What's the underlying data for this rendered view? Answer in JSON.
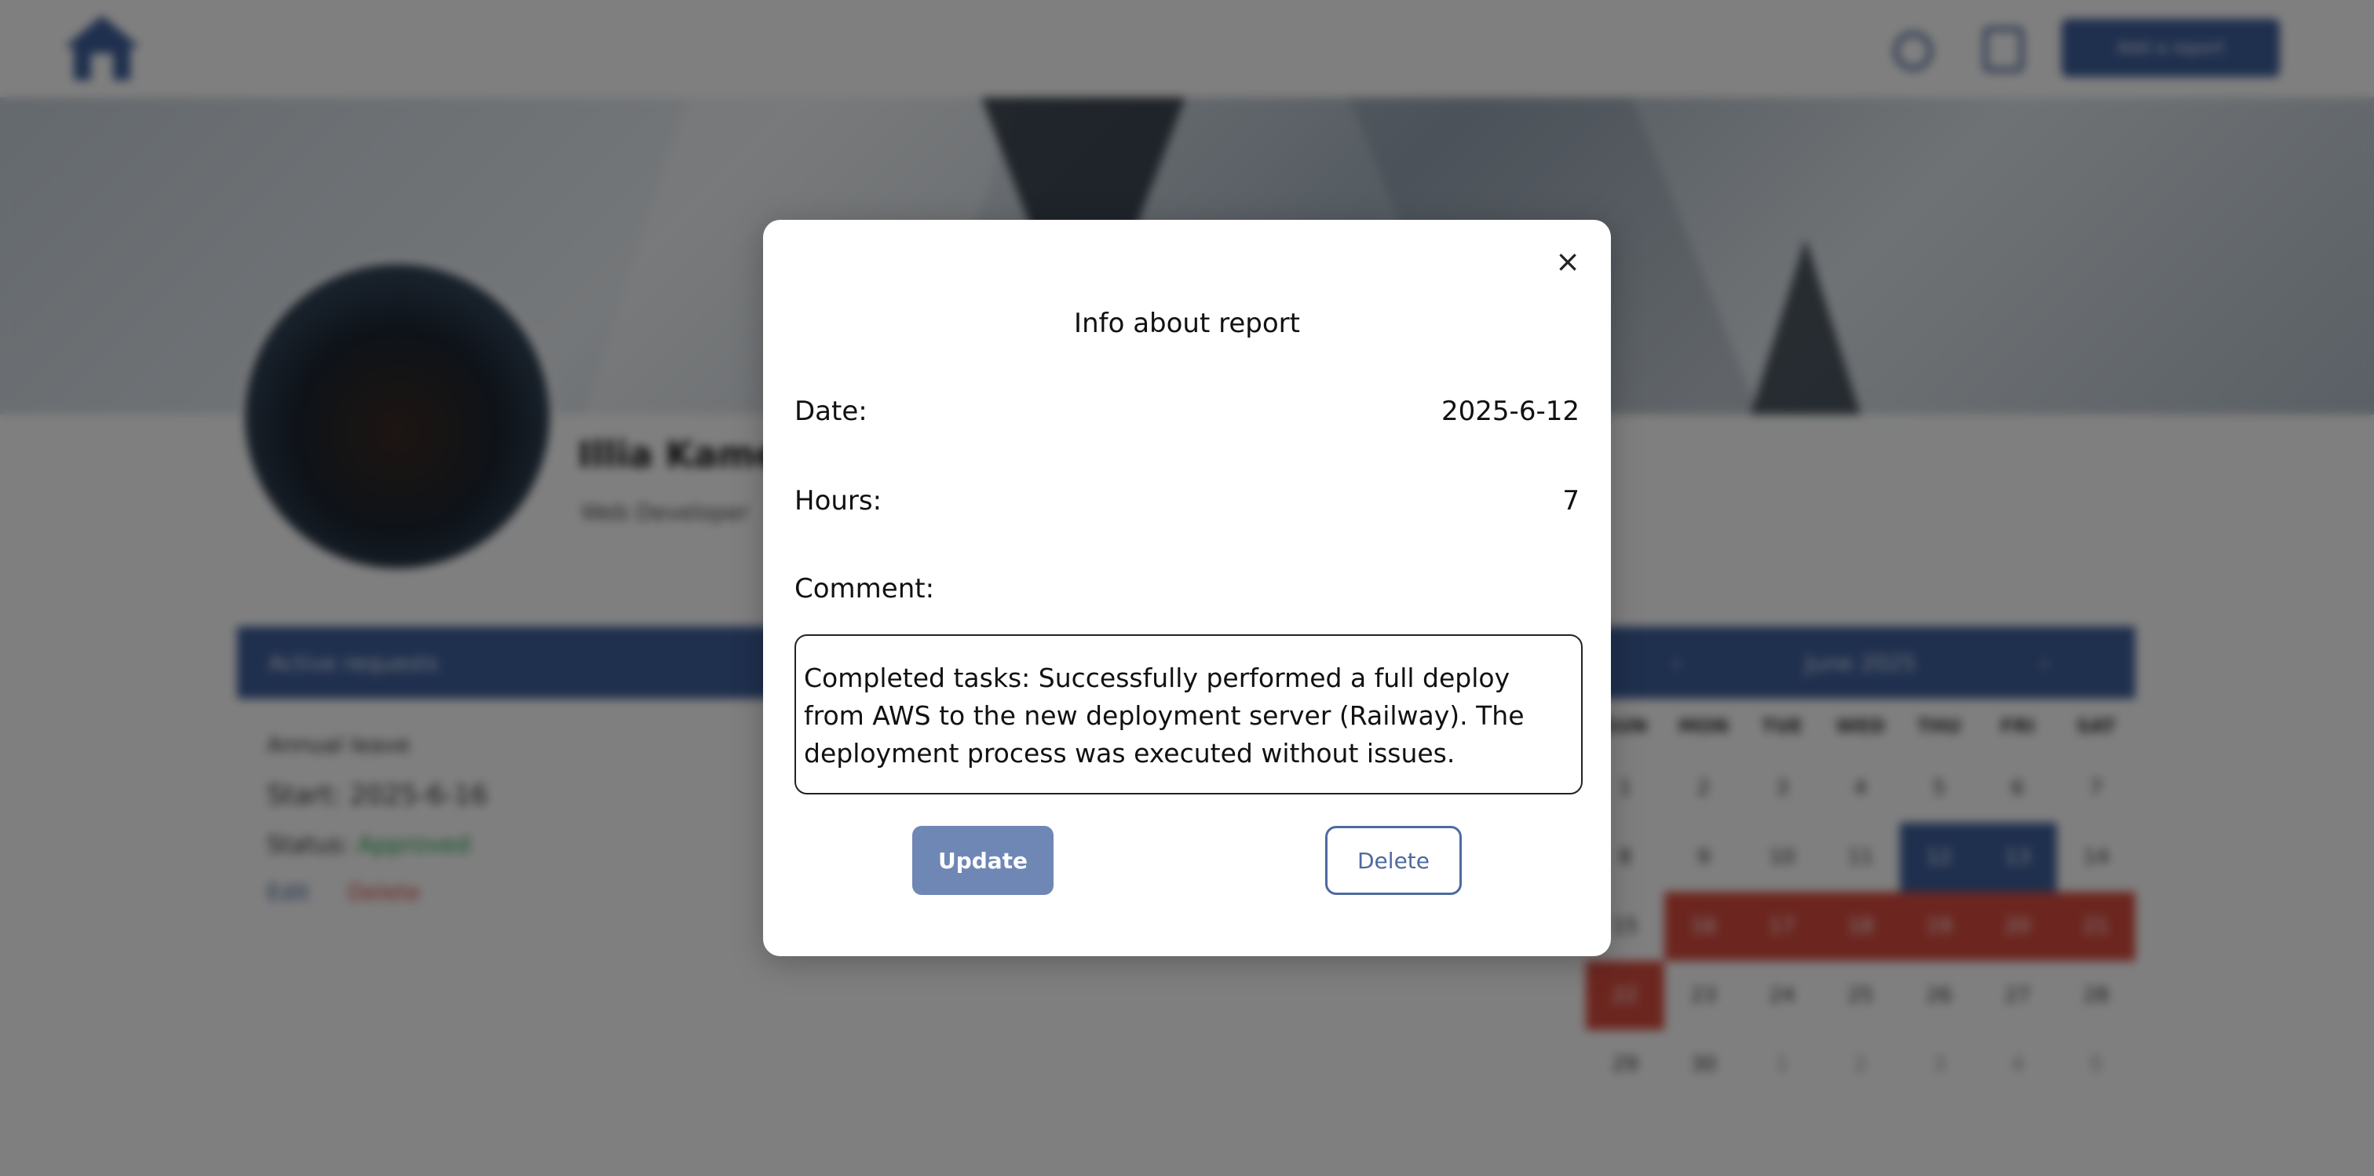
{
  "modal": {
    "close_label": "×",
    "title": "Info about report",
    "date_label": "Date:",
    "date_value": "2025-6-12",
    "hours_label": "Hours:",
    "hours_value": "7",
    "comment_label": "Comment:",
    "comment_value": "Completed tasks: Successfully performed a full deploy from AWS to the new deployment server (Railway). The deployment process was executed without issues.",
    "update_label": "Update",
    "delete_label": "Delete"
  },
  "colors": {
    "primary": "#3e5f9c",
    "update_button": "#6f87b5",
    "overlay": "rgba(0,0,0,0.5)",
    "calendar_highlight_red": "#d94c3f",
    "calendar_highlight_blue": "#3e5f9c"
  },
  "icons": {
    "logo": "home-icon",
    "nav_1": "settings-icon",
    "nav_2": "logout-icon",
    "close": "close-icon"
  },
  "background": {
    "nav_button_label": "Add a report",
    "user_name": "Illia Kamenev",
    "user_role": "Web Developer",
    "requests_panel": {
      "title": "Active requests",
      "type": "Annual leave",
      "start": "Start: 2025-6-16",
      "status_label": "Status:",
      "status_value": "Approved",
      "edit": "Edit",
      "delete": "Delete"
    },
    "calendar": {
      "month": "June 2025",
      "prev": "‹",
      "next": "›",
      "weekdays": [
        "SUN",
        "MON",
        "TUE",
        "WED",
        "THU",
        "FRI",
        "SAT"
      ],
      "days": [
        {
          "d": "1",
          "s": ""
        },
        {
          "d": "2",
          "s": ""
        },
        {
          "d": "3",
          "s": ""
        },
        {
          "d": "4",
          "s": ""
        },
        {
          "d": "5",
          "s": ""
        },
        {
          "d": "6",
          "s": ""
        },
        {
          "d": "7",
          "s": ""
        },
        {
          "d": "8",
          "s": ""
        },
        {
          "d": "9",
          "s": ""
        },
        {
          "d": "10",
          "s": ""
        },
        {
          "d": "11",
          "s": ""
        },
        {
          "d": "12",
          "s": "blue"
        },
        {
          "d": "13",
          "s": "blue"
        },
        {
          "d": "14",
          "s": ""
        },
        {
          "d": "15",
          "s": ""
        },
        {
          "d": "16",
          "s": "red"
        },
        {
          "d": "17",
          "s": "red"
        },
        {
          "d": "18",
          "s": "red"
        },
        {
          "d": "19",
          "s": "red"
        },
        {
          "d": "20",
          "s": "red"
        },
        {
          "d": "21",
          "s": "red"
        },
        {
          "d": "22",
          "s": "red"
        },
        {
          "d": "23",
          "s": ""
        },
        {
          "d": "24",
          "s": ""
        },
        {
          "d": "25",
          "s": ""
        },
        {
          "d": "26",
          "s": ""
        },
        {
          "d": "27",
          "s": ""
        },
        {
          "d": "28",
          "s": ""
        },
        {
          "d": "29",
          "s": ""
        },
        {
          "d": "30",
          "s": ""
        },
        {
          "d": "1",
          "s": "muted"
        },
        {
          "d": "2",
          "s": "muted"
        },
        {
          "d": "3",
          "s": "muted"
        },
        {
          "d": "4",
          "s": "muted"
        },
        {
          "d": "5",
          "s": "muted"
        }
      ]
    }
  }
}
